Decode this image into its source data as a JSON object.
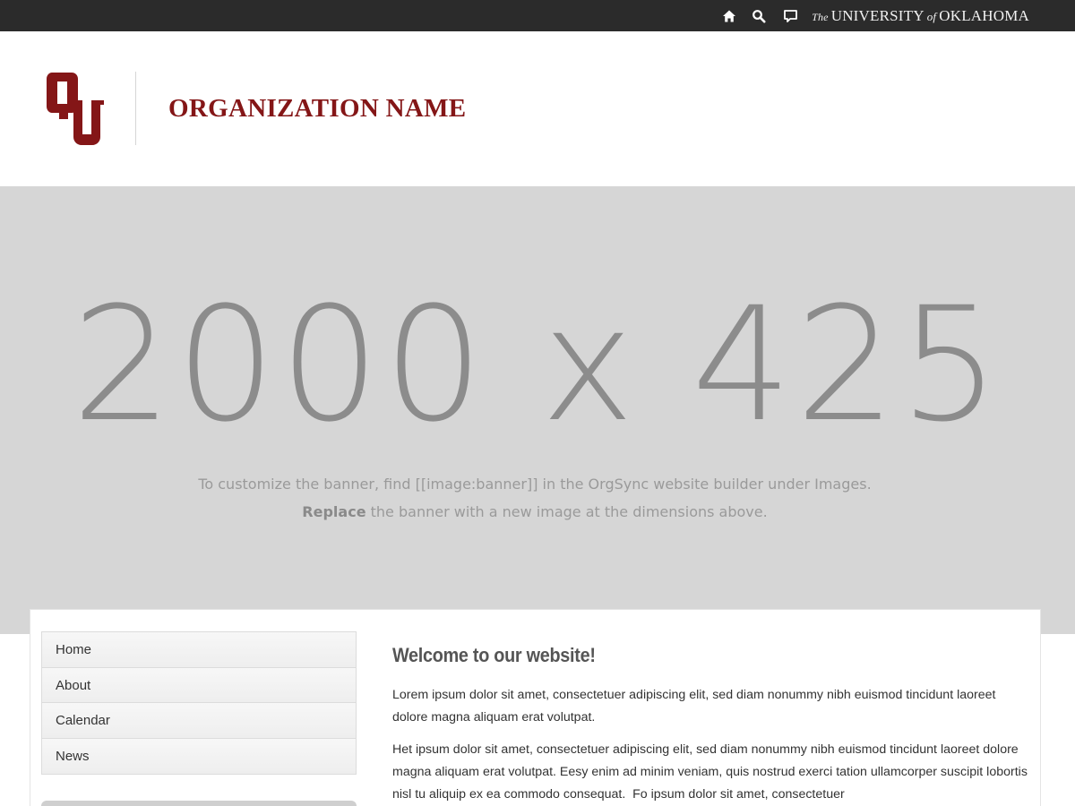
{
  "topbar": {
    "icons": [
      "home-icon",
      "search-icon",
      "chat-icon"
    ],
    "university_small": "The",
    "university_main": "UNIVERSITY",
    "university_of": "of",
    "university_end": "OKLAHOMA"
  },
  "header": {
    "org_name": "ORGANIZATION NAME",
    "logo_icon": "ou-logo",
    "brand_color": "#841617"
  },
  "banner": {
    "dimensions": "2000 x 425",
    "line1": "To customize the banner, find [[image:banner]] in the OrgSync website builder under Images.",
    "line2_bold": "Replace",
    "line2_rest": " the banner with a new image at the dimensions above."
  },
  "nav": {
    "items": [
      {
        "label": "Home"
      },
      {
        "label": "About"
      },
      {
        "label": "Calendar"
      },
      {
        "label": "News"
      }
    ]
  },
  "main": {
    "title": "Welcome to our website!",
    "para1": "Lorem ipsum dolor sit amet, consectetuer adipiscing elit, sed diam nonummy nibh euismod tincidunt laoreet dolore magna aliquam erat volutpat.",
    "para2": "Het ipsum dolor sit amet, consectetuer adipiscing elit, sed diam nonummy nibh euismod tincidunt laoreet dolore magna aliquam erat volutpat. Eesy enim ad minim veniam, quis nostrud exerci tation ullamcorper suscipit lobortis nisl tu aliquip ex ea commodo consequat.  Fo ipsum dolor sit amet, consectetuer"
  }
}
